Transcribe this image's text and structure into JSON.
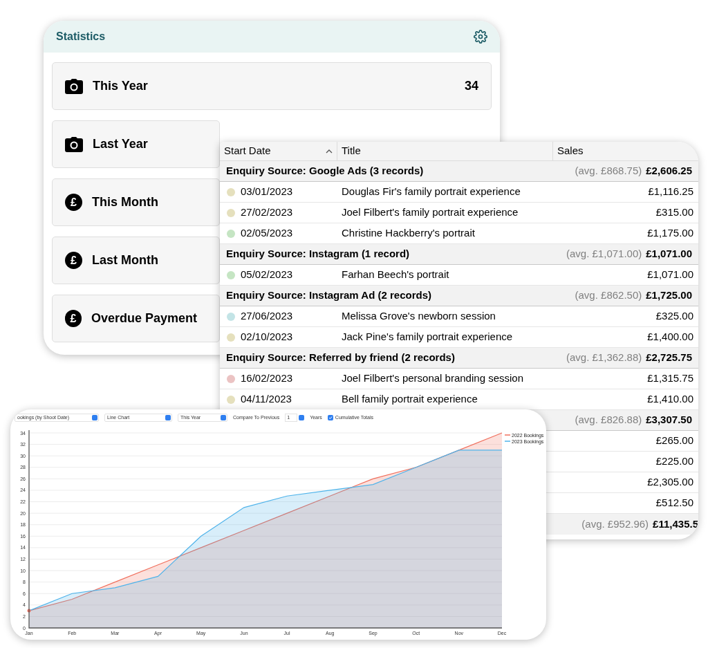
{
  "statistics": {
    "title": "Statistics",
    "cards": [
      {
        "kind": "camera",
        "label": "This Year",
        "value": "34"
      },
      {
        "kind": "camera",
        "label": "Last Year"
      },
      {
        "kind": "currency",
        "symbol": "£",
        "label": "This Month"
      },
      {
        "kind": "currency",
        "symbol": "£",
        "label": "Last Month"
      },
      {
        "kind": "currency",
        "symbol": "£",
        "label": "Overdue Payment"
      }
    ]
  },
  "table": {
    "columns": [
      {
        "label": "Start Date",
        "sorted": true
      },
      {
        "label": "Title",
        "sorted": false
      },
      {
        "label": "Sales",
        "sorted": false
      }
    ],
    "groups": [
      {
        "label": "Enquiry Source: Google Ads (3 records)",
        "avg": "(avg. £868.75)",
        "total": "£2,606.25",
        "rows": [
          {
            "color": "#e5e0bd",
            "date": "03/01/2023",
            "title": "Douglas Fir's family portrait experience",
            "sales": "£1,116.25"
          },
          {
            "color": "#e5e0bd",
            "date": "27/02/2023",
            "title": "Joel Filbert's family portrait experience",
            "sales": "£315.00"
          },
          {
            "color": "#c5e5c3",
            "date": "02/05/2023",
            "title": "Christine Hackberry's portrait",
            "sales": "£1,175.00"
          }
        ]
      },
      {
        "label": "Enquiry Source: Instagram (1 record)",
        "avg": "(avg. £1,071.00)",
        "total": "£1,071.00",
        "rows": [
          {
            "color": "#c5e5c3",
            "date": "05/02/2023",
            "title": "Farhan Beech's portrait",
            "sales": "£1,071.00"
          }
        ]
      },
      {
        "label": "Enquiry Source: Instagram Ad (2 records)",
        "avg": "(avg. £862.50)",
        "total": "£1,725.00",
        "rows": [
          {
            "color": "#c3e4e6",
            "date": "27/06/2023",
            "title": "Melissa Grove's newborn session",
            "sales": "£325.00"
          },
          {
            "color": "#e5e0bd",
            "date": "02/10/2023",
            "title": "Jack Pine's family portrait experience",
            "sales": "£1,400.00"
          }
        ]
      },
      {
        "label": "Enquiry Source: Referred by friend (2 records)",
        "avg": "(avg. £1,362.88)",
        "total": "£2,725.75",
        "rows": [
          {
            "color": "#ebc3c3",
            "date": "16/02/2023",
            "title": "Joel Filbert's personal branding session",
            "sales": "£1,315.75"
          },
          {
            "color": "#e5e0bd",
            "date": "04/11/2023",
            "title": "Bell family portrait experience",
            "sales": "£1,410.00"
          }
        ]
      },
      {
        "avg": "(avg. £826.88)",
        "total": "£3,307.50",
        "rows": [
          {
            "sales": "£265.00"
          },
          {
            "sales": "£225.00"
          },
          {
            "sales": "£2,305.00"
          },
          {
            "sales": "£512.50"
          }
        ]
      }
    ],
    "summary": {
      "avg": "(avg. £952.96)",
      "total": "£11,435.5"
    }
  },
  "chart": {
    "controls": [
      {
        "kind": "popup",
        "value": "ookings (by Shoot Date)"
      },
      {
        "kind": "popup",
        "value": "Line Chart"
      },
      {
        "kind": "popup",
        "value": "This Year"
      },
      {
        "kind": "label",
        "text": "Compare To Previous"
      },
      {
        "kind": "stepper",
        "value": "1"
      },
      {
        "kind": "label",
        "text": "Years"
      },
      {
        "kind": "checkbox",
        "label": "Cumulative Totals",
        "checked": true
      }
    ],
    "chart_data": {
      "type": "area",
      "grid": true,
      "legend": true,
      "categories": [
        "Jan",
        "Feb",
        "Mar",
        "Apr",
        "May",
        "Jun",
        "Jul",
        "Aug",
        "Sep",
        "Oct",
        "Nov",
        "Dec"
      ],
      "ylim": [
        0,
        34
      ],
      "yticks": [
        0,
        2,
        4,
        6,
        8,
        10,
        12,
        14,
        16,
        18,
        20,
        22,
        24,
        26,
        28,
        30,
        32,
        34
      ],
      "series": [
        {
          "name": "2022 Bookings",
          "color": "#f0705e",
          "values": [
            3,
            5,
            8,
            11,
            14,
            17,
            20,
            23,
            26,
            28,
            31,
            34
          ]
        },
        {
          "name": "2023 Bookings",
          "color": "#4fb3ea",
          "values": [
            3,
            6,
            7,
            9,
            16,
            21,
            23,
            24,
            25,
            28,
            31,
            31
          ]
        }
      ]
    }
  }
}
